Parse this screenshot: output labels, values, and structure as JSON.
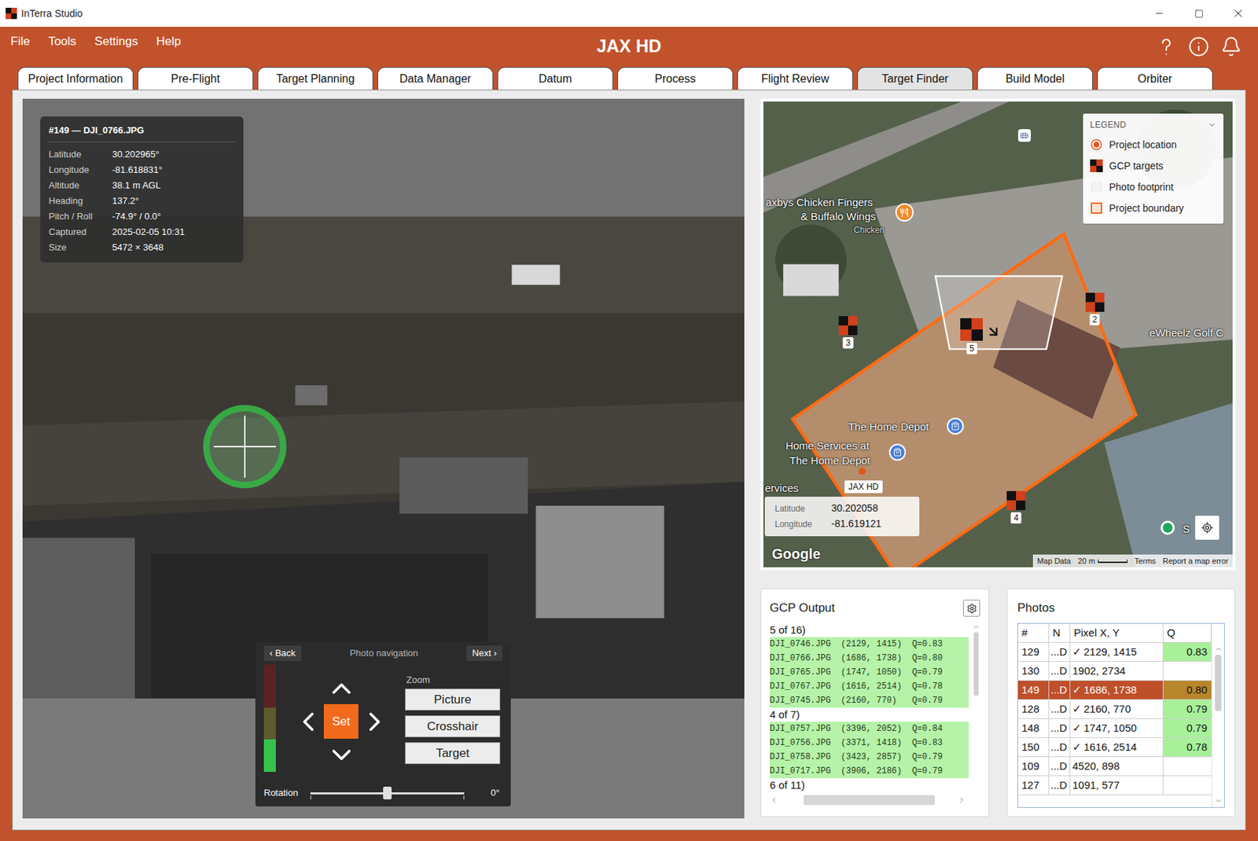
{
  "window": {
    "title": "InTerra Studio"
  },
  "menu": [
    "File",
    "Tools",
    "Settings",
    "Help"
  ],
  "project_title": "JAX HD",
  "tabs": [
    {
      "label": "Project Information",
      "selected": false
    },
    {
      "label": "Pre-Flight",
      "selected": false
    },
    {
      "label": "Target Planning",
      "selected": false
    },
    {
      "label": "Data Manager",
      "selected": false
    },
    {
      "label": "Datum",
      "selected": false
    },
    {
      "label": "Process",
      "selected": false
    },
    {
      "label": "Flight Review",
      "selected": false
    },
    {
      "label": "Target Finder",
      "selected": true
    },
    {
      "label": "Build Model",
      "selected": false
    },
    {
      "label": "Orbiter",
      "selected": false
    }
  ],
  "photo_info": {
    "title": "#149 — DJI_0766.JPG",
    "fields": [
      {
        "label": "Latitude",
        "value": "30.202965°"
      },
      {
        "label": "Longitude",
        "value": "-81.618831°"
      },
      {
        "label": "Altitude",
        "value": "38.1 m AGL"
      },
      {
        "label": "Heading",
        "value": "137.2°"
      },
      {
        "label": "Pitch / Roll",
        "value": "-74.9° / 0.0°"
      },
      {
        "label": "Captured",
        "value": "2025-02-05 10:31"
      },
      {
        "label": "Size",
        "value": "5472 × 3648"
      }
    ]
  },
  "photo_nav": {
    "back": "‹ Back",
    "title": "Photo navigation",
    "next": "Next ›",
    "set": "Set",
    "zoom_label": "Zoom",
    "zoom_buttons": [
      "Picture",
      "Crosshair",
      "Target"
    ],
    "rotation_label": "Rotation",
    "rotation_value": "0°",
    "rotation_level": 0.5,
    "meter_level": 0.3
  },
  "map": {
    "legend_title": "LEGEND",
    "legend": [
      {
        "label": "Project location",
        "kind": "location"
      },
      {
        "label": "GCP targets",
        "kind": "target"
      },
      {
        "label": "Photo footprint",
        "kind": "footprint"
      },
      {
        "label": "Project boundary",
        "kind": "boundary"
      }
    ],
    "targets": [
      {
        "label": "3",
        "selected": false
      },
      {
        "label": "5",
        "selected": true
      },
      {
        "label": "2",
        "selected": false
      },
      {
        "label": "4",
        "selected": false
      }
    ],
    "labels": [
      {
        "text": "axbys Chicken Fingers",
        "kind": "place"
      },
      {
        "text": "& Buffalo Wings",
        "kind": "place"
      },
      {
        "text": "Chicken",
        "kind": "minor"
      },
      {
        "text": "The Home Depot",
        "kind": "place"
      },
      {
        "text": "Home Services at",
        "kind": "place"
      },
      {
        "text": "The Home Depot",
        "kind": "place"
      },
      {
        "text": "eWheelz Golf C",
        "kind": "place"
      },
      {
        "text": "ervices",
        "kind": "place"
      },
      {
        "text": "S",
        "kind": "place"
      }
    ],
    "project_label": "JAX HD",
    "coords": [
      {
        "label": "Latitude",
        "value": "30.202058"
      },
      {
        "label": "Longitude",
        "value": "-81.619121"
      }
    ],
    "attribution": "Google",
    "footer": [
      "Map Data",
      "20 m",
      "Terms",
      "Report a map error"
    ]
  },
  "gcp_output": {
    "title": "GCP Output",
    "groups": [
      {
        "header": "5 of 16)",
        "lines": [
          "DJI_0746.JPG  (2129, 1415)  Q=0.83",
          "DJI_0766.JPG  (1686, 1738)  Q=0.80",
          "DJI_0765.JPG  (1747, 1050)  Q=0.79",
          "DJI_0767.JPG  (1616, 2514)  Q=0.78",
          "DJI_0745.JPG  (2160, 770)   Q=0.79"
        ]
      },
      {
        "header": "4 of 7)",
        "lines": [
          "DJI_0757.JPG  (3396, 2052)  Q=0.84",
          "DJI_0756.JPG  (3371, 1418)  Q=0.83",
          "DJI_0758.JPG  (3423, 2857)  Q=0.79",
          "DJI_0717.JPG  (3906, 2186)  Q=0.79"
        ]
      },
      {
        "header": "6 of 11)",
        "lines": []
      }
    ]
  },
  "photos": {
    "title": "Photos",
    "check_mark": "✓",
    "columns": [
      "#",
      "N",
      "Pixel X, Y",
      "Q"
    ],
    "rows": [
      {
        "id": "129",
        "n": "...D",
        "checked": true,
        "pixel": "2129, 1415",
        "q": "0.83",
        "selected": false
      },
      {
        "id": "130",
        "n": "...D",
        "checked": false,
        "pixel": "1902, 2734",
        "q": "",
        "selected": false
      },
      {
        "id": "149",
        "n": "...D",
        "checked": true,
        "pixel": "1686, 1738",
        "q": "0.80",
        "selected": true
      },
      {
        "id": "128",
        "n": "...D",
        "checked": true,
        "pixel": "2160, 770",
        "q": "0.79",
        "selected": false
      },
      {
        "id": "148",
        "n": "...D",
        "checked": true,
        "pixel": "1747, 1050",
        "q": "0.79",
        "selected": false
      },
      {
        "id": "150",
        "n": "...D",
        "checked": true,
        "pixel": "1616, 2514",
        "q": "0.78",
        "selected": false
      },
      {
        "id": "109",
        "n": "...D",
        "checked": false,
        "pixel": "4520, 898",
        "q": "",
        "selected": false
      },
      {
        "id": "127",
        "n": "...D",
        "checked": false,
        "pixel": "1091, 577",
        "q": "",
        "selected": false
      }
    ]
  }
}
